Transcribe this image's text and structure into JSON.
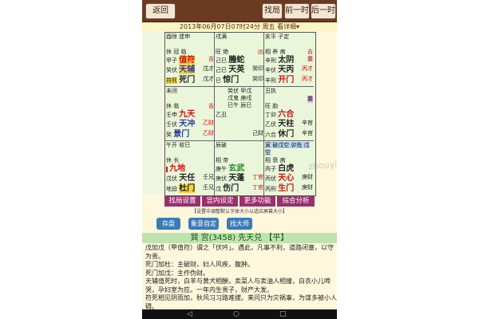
{
  "topbar": {
    "back": "返回",
    "find": "找局",
    "prev": "前一时",
    "next": "后一时"
  },
  "datebar": "2013年06月07日07时24分 周五 看详细▾",
  "cells": {
    "c1": {
      "head": "酉除 建申",
      "r1": "休 冠 临",
      "r2a": "甲子",
      "r2b": "值符",
      "r2c": "吉",
      "r3a": "癸伏",
      "r3b": "天辅",
      "r3c": "戊才",
      "r4a": "符死",
      "r4b": "死门",
      "r4c": "戊才"
    },
    "c2": {
      "head": "戌满",
      "r1": "旺 绝",
      "r1c": "凶",
      "r2a": "己巳",
      "r2b": "螣蛇",
      "r3a": "己巳",
      "r3b": "天英",
      "r3c": "癸印",
      "r4a": "巳",
      "r4b": "惊门",
      "r4c": "癸印"
    },
    "c3": {
      "head": "亥平 子定",
      "r1": "相 养 病",
      "r1c": "吉",
      "r2a": "辛刑",
      "r2b": "太阴",
      "r2c": "囊",
      "r3a": "辛伏",
      "r3b": "天丙",
      "r3c": "丙才",
      "r4a": "辛刑",
      "r4b": "开门",
      "r4c": "丙才"
    },
    "c4": {
      "head": "未闭",
      "r1": "休 临",
      "r1c": "吉",
      "r2a": "壬申",
      "r2b": "九天",
      "r3a": "壬伏",
      "r3b": "天冲",
      "r3c": "乙财",
      "r4a": "癸",
      "r4b": "景门",
      "r4c": "乙财"
    },
    "c5": {
      "head": "癸伏 甲戊",
      "r1": "戊鬼 庚戌",
      "r1b": "巳午 辰巳",
      "r2a": "乙丑",
      "r3a": "乙丑",
      "r3c": "己财",
      "r4a": "",
      "r4c": "己财"
    },
    "c6": {
      "head": "丑执",
      "r1": "旺 胎",
      "r1c": "囊",
      "r2a": "丁卯",
      "r2b": "六合",
      "r3a": "乙伏",
      "r3b": "天柱",
      "r3c": "辛官",
      "r4a": "六合",
      "r4b": "休门",
      "r4c": "辛官"
    },
    "c7": {
      "head": "午开 收巳",
      "r1": "休 长",
      "r1c": "",
      "r2a": "",
      "r2b": "九地",
      "r3a": "戊伏",
      "r3b": "天任",
      "r3c": "壬兄",
      "r4a": "地迫",
      "r4b": "杜门",
      "r4c": "壬兄"
    },
    "c8": {
      "head": "辰破",
      "r1": "相 帝",
      "r1c": "",
      "r2a": "庚午",
      "r2b": "玄武",
      "r3a": "庚伏",
      "r3b": "天蓬",
      "r3c": "丁官",
      "r4a": "戊",
      "r4b": "伤门",
      "r4c": "丁官"
    },
    "c9": {
      "head": "寅 破戊空 卯危 戊空",
      "r1": "相 衰 病",
      "r1c": "",
      "r2a": "丙子",
      "r2b": "白虎",
      "r3a": "丙伏",
      "r3b": "天心",
      "r3c": "庚财",
      "r4a": "丙刑",
      "r4b": "生门",
      "r4c": "庚财"
    }
  },
  "menu": [
    "找局设置",
    "宫内设定",
    "更多功能",
    "综合分析"
  ],
  "note": "【设置中调整默认字体大小以适应屏幕大小】",
  "actions": [
    "存盘",
    "象意自定",
    "找大师"
  ],
  "palace_title": "巽 宫(3458) 先天兑 【平】",
  "desc_lines": [
    "戊加戊（甲值符）谓之「伏吟」。遇此，凡事不利，道路闭塞，以守",
    "为贵。",
    "死门加杜：主破财，妇人风疾，腹肿。",
    "死门加戊：主作伪财。",
    "天辅值死时，白羊与黄犬相酬，卖菜人与卖油人相撞，白衣小儿啼",
    "哭，孕妇室为应。一年内生贵子，财产大发。",
    "符死相见阴雨加，秋风习习路难拔。来问只为灾祸事，为谋多被小人",
    "碍。"
  ],
  "watermark": "zhouyi.taobao.com"
}
